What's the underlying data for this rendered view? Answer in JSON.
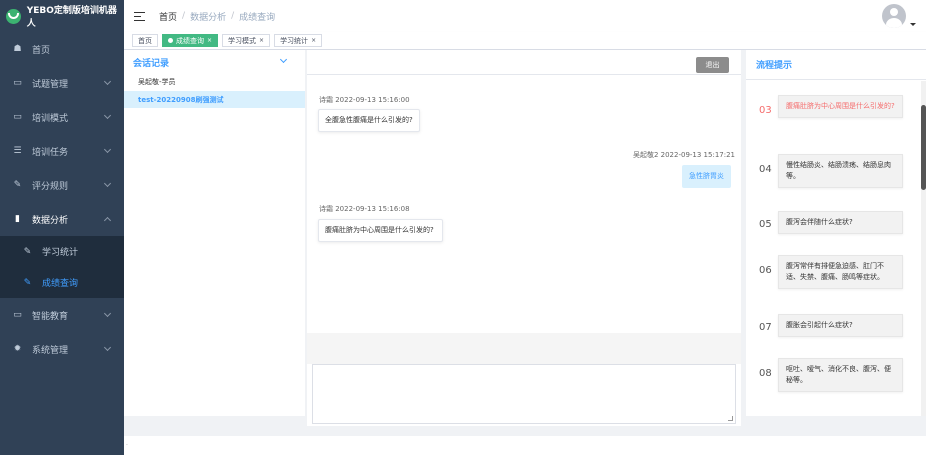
{
  "app": {
    "brand": "YEBO定制版培训机器人"
  },
  "sidebar": {
    "items": [
      {
        "label": "首页",
        "icon": "dashboard-icon",
        "glyph": "☗"
      },
      {
        "label": "试题管理",
        "icon": "book-icon",
        "glyph": "▭"
      },
      {
        "label": "培训模式",
        "icon": "monitor-icon",
        "glyph": "▭"
      },
      {
        "label": "培训任务",
        "icon": "list-icon",
        "glyph": "☰"
      },
      {
        "label": "评分规则",
        "icon": "edit-icon",
        "glyph": "✎"
      },
      {
        "label": "数据分析",
        "icon": "chart-icon",
        "glyph": "▮"
      },
      {
        "label": "学习统计",
        "icon": "edit-icon",
        "glyph": "✎"
      },
      {
        "label": "成绩查询",
        "icon": "edit-icon",
        "glyph": "✎"
      },
      {
        "label": "智能教育",
        "icon": "message-icon",
        "glyph": "▭"
      },
      {
        "label": "系统管理",
        "icon": "gear-icon",
        "glyph": "✹"
      }
    ]
  },
  "breadcrumb": {
    "home": "首页",
    "section": "数据分析",
    "current": "成绩查询"
  },
  "tags": [
    {
      "label": "首页"
    },
    {
      "label": "成绩查询",
      "close": "×"
    },
    {
      "label": "学习模式",
      "close": "×"
    },
    {
      "label": "学习统计",
      "close": "×"
    }
  ],
  "session": {
    "title": "会话记录",
    "user": "吴起敬-学员",
    "item": "test-20220908刷强测试"
  },
  "chat": {
    "exit_label": "退出",
    "messages": [
      {
        "meta": "诗霜 2022-09-13 15:16:00",
        "text": "全腹急性腹痛是什么引发的?"
      },
      {
        "meta": "吴起敬2 2022-09-13 15:17:21",
        "text": "急性脐胃炎"
      },
      {
        "meta": "诗霜 2022-09-13 15:16:08",
        "text": "腹痛肚脐为中心周围是什么引发的?"
      }
    ]
  },
  "flow": {
    "title": "流程提示",
    "steps": [
      {
        "num": "03",
        "text": "腹痛肚脐为中心周围是什么引发的?"
      },
      {
        "num": "04",
        "text": "慢性结肠炎、结肠溃疡、结肠息肉等。"
      },
      {
        "num": "05",
        "text": "腹泻会伴随什么症状?"
      },
      {
        "num": "06",
        "text": "腹泻常伴有排便急迫感、肛门不适、失禁、腹痛、肠鸣等症状。"
      },
      {
        "num": "07",
        "text": "腹胀会引起什么症状?"
      },
      {
        "num": "08",
        "text": "呕吐、嗳气、消化不良、腹泻、便秘等。"
      }
    ]
  },
  "footer": {
    "text": "."
  },
  "colors": {
    "sidebar_bg": "#304156",
    "accent": "#409eff",
    "tag_active": "#42b983",
    "highlight": "#f56c6c"
  }
}
